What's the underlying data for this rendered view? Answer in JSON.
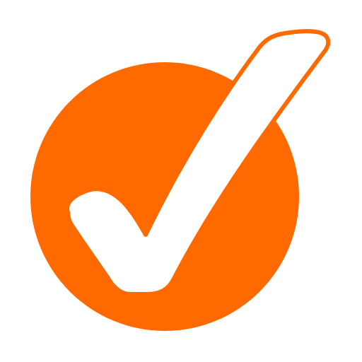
{
  "icon": {
    "name": "checkmark-circle-icon",
    "colors": {
      "background": "#ffffff",
      "circle": "#ff6a00",
      "check": "#ffffff",
      "check_outline": "#ff6a00"
    }
  }
}
